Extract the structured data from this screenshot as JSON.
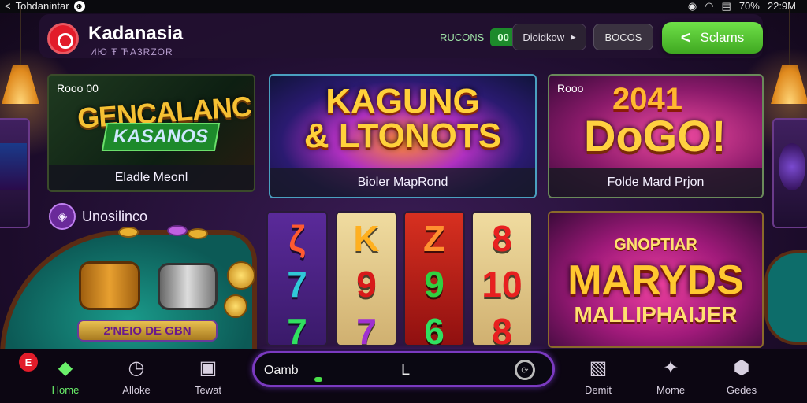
{
  "status_bar": {
    "app_name": "Tohdanintar",
    "time": "22:9M",
    "battery": "70%"
  },
  "header": {
    "brand": "Kadanasia",
    "tagline": "ИЮ Ŧ ЋA3RZOR",
    "bonus_label": "RUCONS",
    "bonus_badge": "00",
    "promo_label": "Dioidkow",
    "promo_arrow": "▸",
    "bonus2_label": "BOCOS",
    "cta_label": "Sclams"
  },
  "cards": {
    "card1": {
      "tag": "Rooo 00",
      "art_line1": "GENCALANC",
      "art_line2": "KASANOS",
      "caption": "Eladle Meonl"
    },
    "card2": {
      "art_line1": "KAGUNG",
      "art_line2": "& LTONOTS",
      "caption": "Bioler MapRond"
    },
    "card3": {
      "tag": "Rooo",
      "art_line1": "2041",
      "art_line2": "DoGO!",
      "caption": "Folde Mard Prjon"
    },
    "card5": {
      "art_line1": "GNOPTIAR",
      "art_line2": "MARYDS",
      "art_line3": "MALLIPHAIJER"
    }
  },
  "section": {
    "title": "Unosilinco"
  },
  "poker": {
    "label": "2'NEIO DE GBN"
  },
  "reels": {
    "r1": [
      "ζ",
      "7",
      "7"
    ],
    "r2": [
      "K",
      "9",
      "7"
    ],
    "r3": [
      "Z",
      "9",
      "6"
    ],
    "r4": [
      "8",
      "10",
      "8"
    ]
  },
  "nav": {
    "items": [
      {
        "label": "Home",
        "icon": "home-gem-icon"
      },
      {
        "label": "Alloke",
        "icon": "clock-icon"
      },
      {
        "label": "Tewat",
        "icon": "chart-icon"
      },
      {
        "label": "Demit",
        "icon": "card-icon"
      },
      {
        "label": "Mome",
        "icon": "star-icon"
      },
      {
        "label": "Gedes",
        "icon": "badge-icon"
      }
    ],
    "notif_badge": "E",
    "player_text": "Oamb",
    "player_mid": "L"
  }
}
